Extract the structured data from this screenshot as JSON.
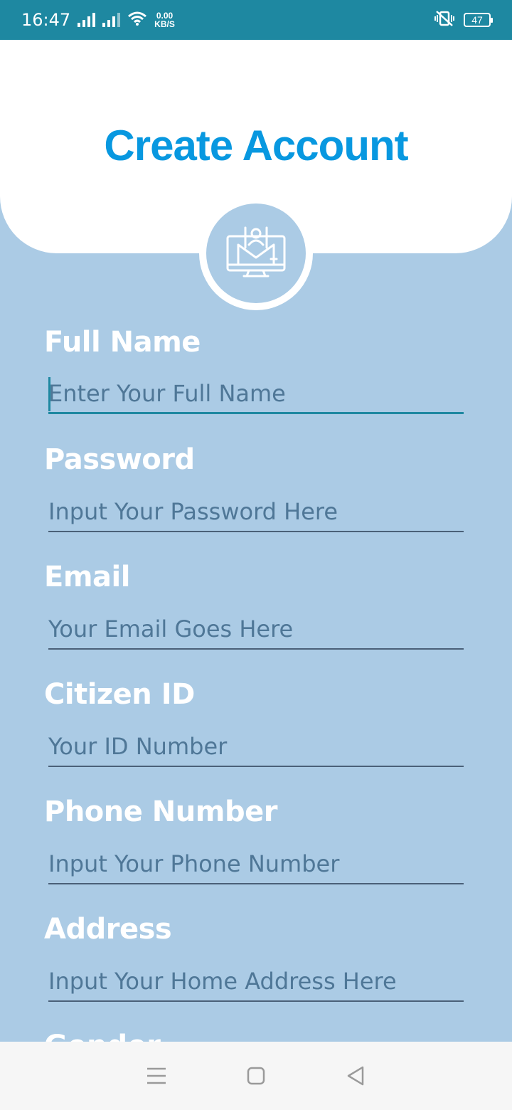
{
  "status_bar": {
    "time": "16:47",
    "net_speed_value": "0.00",
    "net_speed_unit": "KB/S",
    "battery": "47"
  },
  "page": {
    "title": "Create Account"
  },
  "form": {
    "full_name": {
      "label": "Full Name",
      "placeholder": "Enter Your Full Name",
      "value": ""
    },
    "password": {
      "label": "Password",
      "placeholder": "Input Your Password Here",
      "value": ""
    },
    "email": {
      "label": "Email",
      "placeholder": "Your Email Goes Here",
      "value": ""
    },
    "citizen_id": {
      "label": "Citizen ID",
      "placeholder": "Your ID Number",
      "value": ""
    },
    "phone": {
      "label": "Phone Number",
      "placeholder": "Input Your Phone Number",
      "value": ""
    },
    "address": {
      "label": "Address",
      "placeholder": "Input Your Home Address Here",
      "value": ""
    },
    "next_label_partial": "Gender"
  },
  "colors": {
    "status_bar": "#1e88a1",
    "background": "#abcbe5",
    "title": "#0898e0",
    "placeholder": "#4f7797"
  },
  "icons": {
    "avatar": "monitor-user-icon",
    "nav_menu": "menu-lines-icon",
    "nav_home": "square-home-icon",
    "nav_back": "triangle-back-icon"
  }
}
